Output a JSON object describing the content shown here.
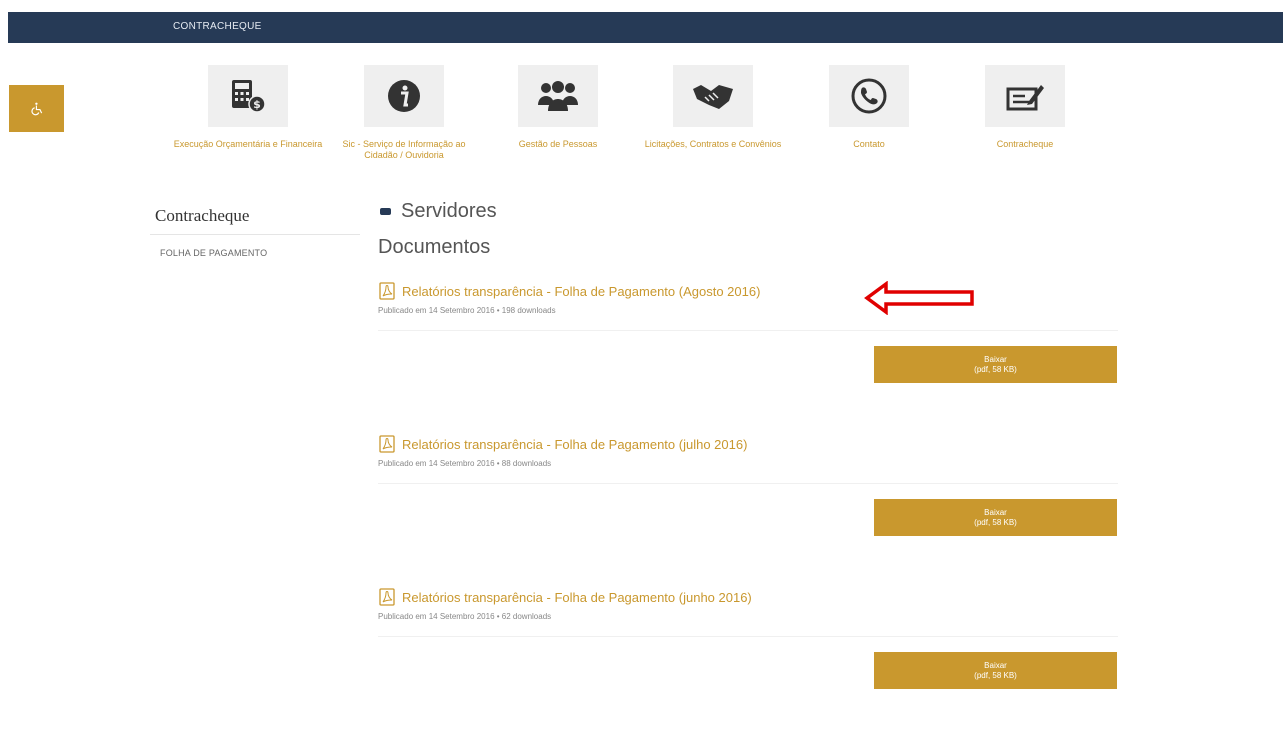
{
  "header": {
    "title": "CONTRACHEQUE"
  },
  "accessibility": {
    "icon": "wheelchair-icon"
  },
  "nav": {
    "items": [
      {
        "label": "Execução Orçamentária e Financeira",
        "icon": "calculator-icon"
      },
      {
        "label": "Sic - Serviço de Informação ao Cidadão / Ouvidoria",
        "icon": "info-icon"
      },
      {
        "label": "Gestão de Pessoas",
        "icon": "people-icon"
      },
      {
        "label": "Licitações, Contratos e Convênios",
        "icon": "handshake-icon"
      },
      {
        "label": "Contato",
        "icon": "phone-icon"
      },
      {
        "label": "Contracheque",
        "icon": "paycheck-icon"
      }
    ]
  },
  "sidebar": {
    "title": "Contracheque",
    "items": [
      {
        "label": "FOLHA DE PAGAMENTO"
      }
    ]
  },
  "main": {
    "category": "Servidores",
    "section_title": "Documentos",
    "documents": [
      {
        "title": "Relatórios transparência - Folha de Pagamento (Agosto 2016)",
        "meta": "Publicado em 14 Setembro 2016 • 198 downloads",
        "button_label": "Baixar",
        "button_size": "(pdf, 58 KB)"
      },
      {
        "title": "Relatórios transparência - Folha de Pagamento (julho 2016)",
        "meta": "Publicado em 14 Setembro 2016 • 88 downloads",
        "button_label": "Baixar",
        "button_size": "(pdf, 58 KB)"
      },
      {
        "title": "Relatórios transparência - Folha de Pagamento (junho 2016)",
        "meta": "Publicado em 14 Setembro 2016 • 62 downloads",
        "button_label": "Baixar",
        "button_size": "(pdf, 58 KB)"
      }
    ]
  },
  "colors": {
    "header_bg": "#263a56",
    "accent": "#c9982e",
    "annotation": "#e00000"
  }
}
